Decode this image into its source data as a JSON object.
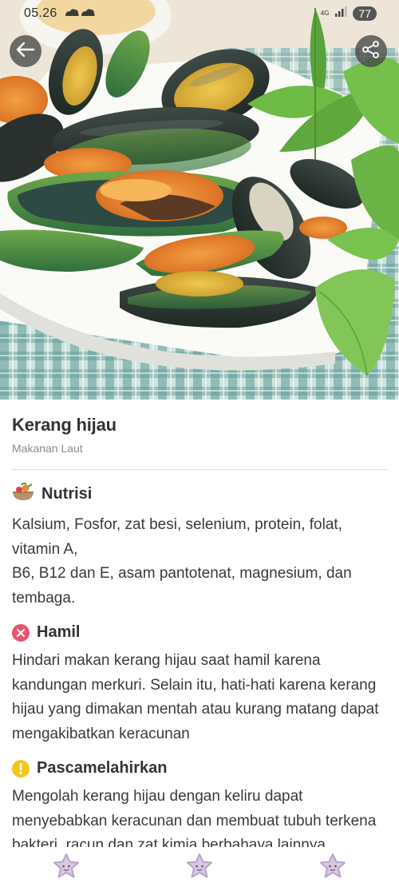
{
  "status_bar": {
    "time": "05.26",
    "network": "4G",
    "battery": "77"
  },
  "header": {
    "back_icon": "arrow-left-icon",
    "share_icon": "share-icon",
    "hero_image": "green-mussels-photo"
  },
  "food": {
    "name": "Kerang hijau",
    "category": "Makanan Laut"
  },
  "sections": {
    "nutrisi": {
      "icon": "food-bowl-icon",
      "title": "Nutrisi",
      "line1": "Kalsium, Fosfor, zat besi, selenium, protein, folat, vitamin A,",
      "line2": "B6, B12 dan E, asam pantotenat, magnesium, dan tembaga."
    },
    "hamil": {
      "icon": "x-circle-icon",
      "title": "Hamil",
      "body": "Hindari makan kerang hijau saat hamil karena kandungan merkuri. Selain itu, hati-hati karena kerang hijau yang dimakan mentah atau kurang matang dapat mengakibatkan keracunan"
    },
    "pascamelahirkan": {
      "icon": "exclamation-circle-icon",
      "title": "Pascamelahirkan",
      "body": "Mengolah kerang hijau dengan keliru dapat menyebabkan keracunan dan membuat tubuh terkena bakteri, racun dan zat kimia berbahaya lainnya"
    }
  },
  "bottom_bar": {
    "icons": [
      "star-face-icon",
      "star-face-icon",
      "star-face-icon"
    ]
  },
  "colors": {
    "danger": "#e8556a",
    "warning": "#f5c51b",
    "icon_purple": "#b9a3c9"
  }
}
